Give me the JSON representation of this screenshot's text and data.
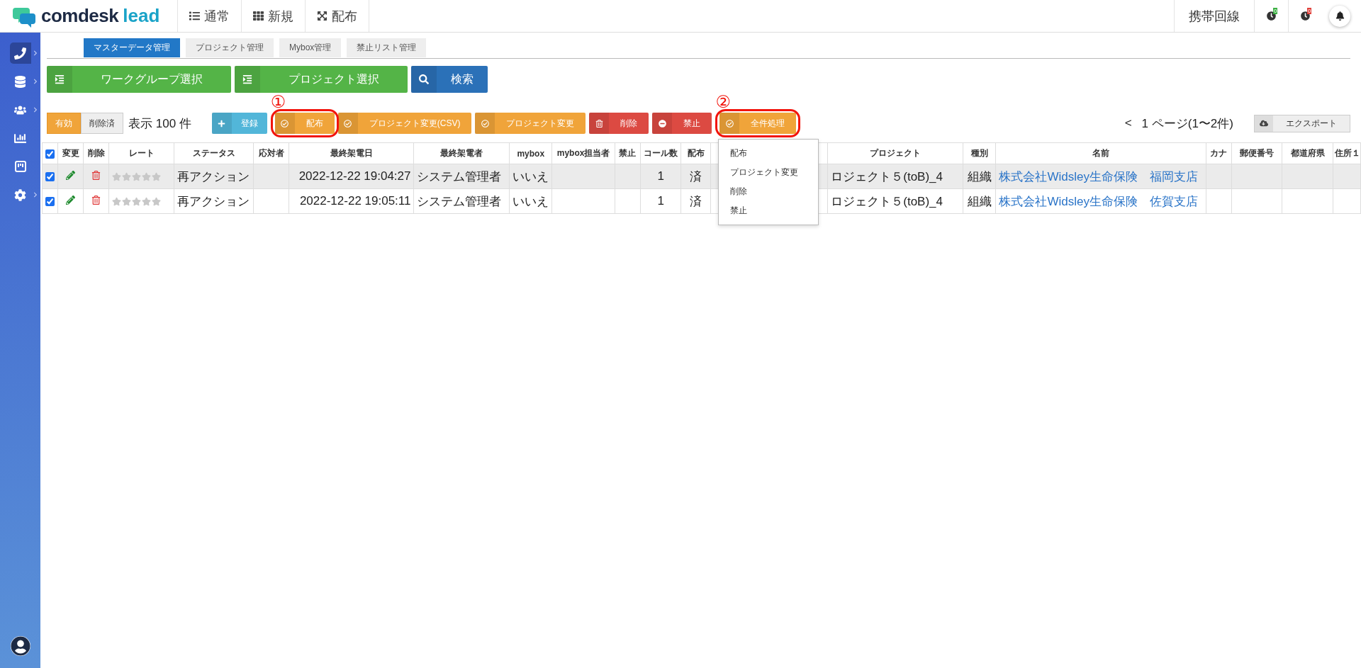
{
  "logo": {
    "brand": "comdesk",
    "product": "lead"
  },
  "nav": [
    {
      "label": "通常",
      "kind": "list"
    },
    {
      "label": "新規",
      "kind": "grid"
    },
    {
      "label": "配布",
      "kind": "expand"
    }
  ],
  "top_right": {
    "line": "携帯回線",
    "timers": [
      {
        "badge": "0",
        "color": "#3cb043"
      },
      {
        "badge": "0",
        "color": "#e0403a"
      }
    ]
  },
  "sidebar": [
    {
      "kind": "phone",
      "selected": true,
      "submenu": true
    },
    {
      "kind": "database",
      "selected": false,
      "submenu": true
    },
    {
      "kind": "users",
      "selected": false,
      "submenu": true
    },
    {
      "kind": "chart",
      "selected": false,
      "submenu": false
    },
    {
      "kind": "board",
      "selected": false,
      "submenu": false
    },
    {
      "kind": "gear",
      "selected": false,
      "submenu": true
    }
  ],
  "tabs": [
    {
      "label": "マスターデータ管理",
      "selected": true
    },
    {
      "label": "プロジェクト管理",
      "selected": false
    },
    {
      "label": "Mybox管理",
      "selected": false
    },
    {
      "label": "禁止リスト管理",
      "selected": false
    }
  ],
  "selectors": [
    {
      "label": "ワークグループ選択",
      "kind": "indent",
      "color": "#54b447"
    },
    {
      "label": "プロジェクト選択",
      "kind": "indent",
      "color": "#54b447"
    },
    {
      "label": "検索",
      "kind": "search",
      "color": "#2b71b8"
    }
  ],
  "filter": [
    {
      "label": "有効",
      "selected": true
    },
    {
      "label": "削除済",
      "selected": false
    }
  ],
  "count_label": "表示 100 件",
  "actions": [
    {
      "label": "登録",
      "kind": "plus",
      "color": "#52b6d9"
    },
    {
      "label": "配布",
      "kind": "check",
      "color": "#f0a43a",
      "annotation": "①"
    },
    {
      "label": "プロジェクト変更(CSV)",
      "kind": "check",
      "color": "#f0a43a"
    },
    {
      "label": "プロジェクト変更",
      "kind": "check",
      "color": "#f0a43a"
    },
    {
      "label": "削除",
      "kind": "trash",
      "color": "#dc4a42"
    },
    {
      "label": "禁止",
      "kind": "minus",
      "color": "#dc4a42"
    },
    {
      "label": "全件処理",
      "kind": "check",
      "color": "#f0a43a",
      "annotation": "②",
      "menu": [
        "配布",
        "プロジェクト変更",
        "削除",
        "禁止"
      ]
    }
  ],
  "pager": {
    "prev": "<",
    "text": "1 ページ(1〜2件)"
  },
  "export": "エクスポート",
  "table": {
    "columns": [
      {
        "kind": "checkbox",
        "checked": true
      },
      {
        "kind": "text",
        "label": "変更"
      },
      {
        "kind": "text",
        "label": "削除"
      },
      {
        "kind": "text",
        "label": "レート"
      },
      {
        "kind": "text",
        "label": "ステータス"
      },
      {
        "kind": "text",
        "label": "応対者"
      },
      {
        "kind": "text",
        "label": "最終架電日"
      },
      {
        "kind": "text",
        "label": "最終架電者"
      },
      {
        "kind": "text",
        "label": "mybox"
      },
      {
        "kind": "text",
        "label": "mybox担当者"
      },
      {
        "kind": "text",
        "label": "禁止"
      },
      {
        "kind": "text",
        "label": "コール数"
      },
      {
        "kind": "text",
        "label": "配布"
      },
      {
        "kind": "blank"
      },
      {
        "kind": "text",
        "label": "プロジェクト"
      },
      {
        "kind": "text",
        "label": "種別"
      },
      {
        "kind": "text",
        "label": "名前"
      },
      {
        "kind": "text",
        "label": "カナ"
      },
      {
        "kind": "text",
        "label": "郵便番号"
      },
      {
        "kind": "text",
        "label": "都道府県"
      },
      {
        "kind": "text",
        "label": "住所１"
      }
    ],
    "rows": [
      {
        "checked": true,
        "highlighted": true,
        "stars": 0,
        "status": "再アクション",
        "last_call": "2022-12-22 19:04:27",
        "last_caller": "システム管理者",
        "mybox": "いいえ",
        "calls": "1",
        "distribution": "済",
        "project": "ロジェクト５(toB)_4",
        "type": "組織",
        "name": "株式会社Widsley生命保険　福岡支店"
      },
      {
        "checked": true,
        "highlighted": false,
        "stars": 0,
        "status": "再アクション",
        "last_call": "2022-12-22 19:05:11",
        "last_caller": "システム管理者",
        "mybox": "いいえ",
        "calls": "1",
        "distribution": "済",
        "project": "ロジェクト５(toB)_4",
        "type": "組織",
        "name": "株式会社Widsley生命保険　佐賀支店"
      }
    ]
  }
}
